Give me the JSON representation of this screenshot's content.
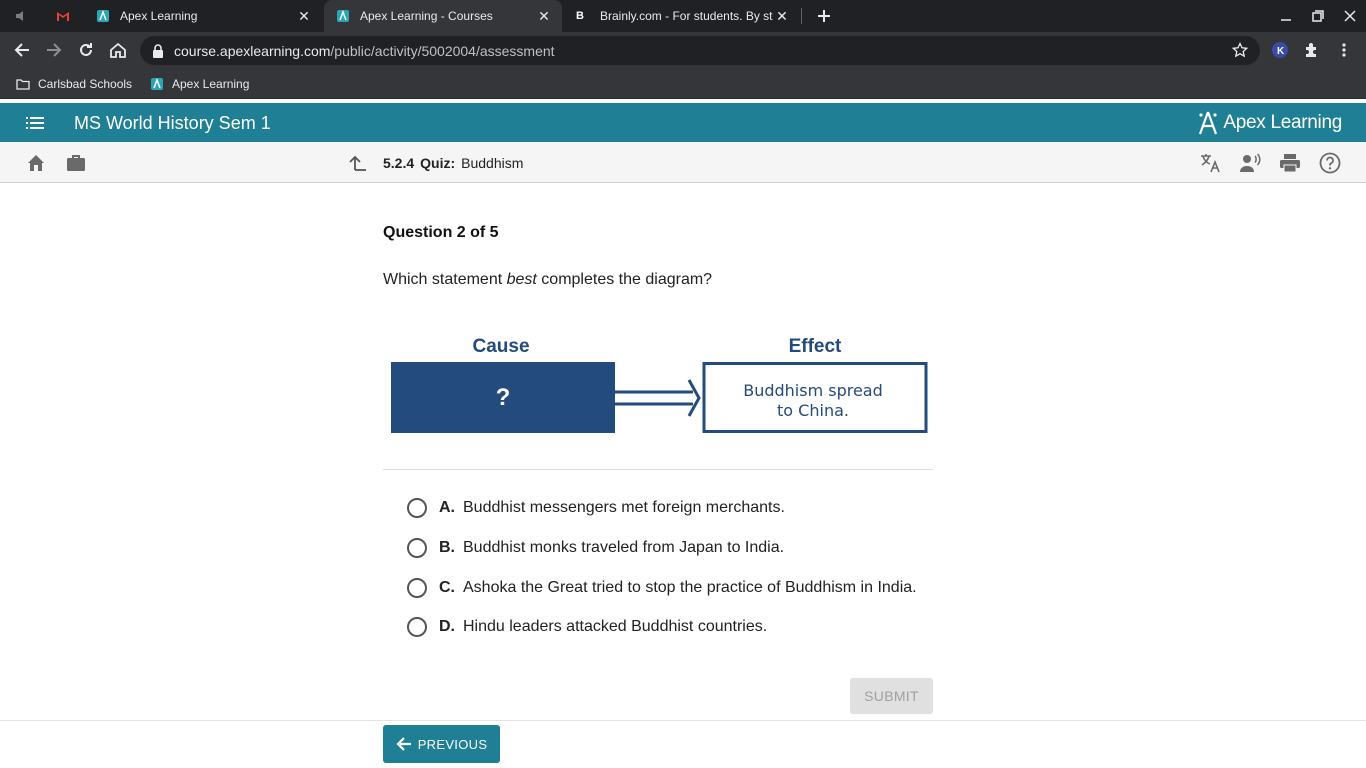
{
  "browser": {
    "tabs": [
      {
        "title": "",
        "favicon": "back-audio-icon"
      },
      {
        "title": "",
        "favicon": "gmail-icon"
      },
      {
        "title": "Apex Learning",
        "favicon": "apex-icon"
      },
      {
        "title": "Apex Learning - Courses",
        "favicon": "apex-icon",
        "active": true
      },
      {
        "title": "Brainly.com - For students. By st",
        "favicon": "brainly-icon"
      }
    ],
    "url_host": "course.apexlearning.com",
    "url_path": "/public/activity/5002004/assessment",
    "bookmarks": [
      {
        "label": "Carlsbad Schools",
        "icon": "folder-icon"
      },
      {
        "label": "Apex Learning",
        "icon": "apex-icon"
      }
    ]
  },
  "app": {
    "course_title": "MS World History Sem 1",
    "brand": "Apex Learning",
    "brand_color": "#1f7f95"
  },
  "breadcrumb": {
    "number": "5.2.4",
    "kind": "Quiz:",
    "name": "Buddhism"
  },
  "question": {
    "counter": "Question 2 of 5",
    "prompt_before": "Which statement ",
    "prompt_em": "best",
    "prompt_after": " completes the diagram?",
    "diagram": {
      "cause_label": "Cause",
      "effect_label": "Effect",
      "cause_text": "?",
      "effect_line1": "Buddhism spread",
      "effect_line2": "to China."
    },
    "choices": [
      {
        "letter": "A.",
        "text": "Buddhist messengers met foreign merchants."
      },
      {
        "letter": "B.",
        "text": "Buddhist monks traveled from Japan to India."
      },
      {
        "letter": "C.",
        "text": "Ashoka the Great tried to stop the practice of Buddhism in India."
      },
      {
        "letter": "D.",
        "text": "Hindu leaders attacked Buddhist countries."
      }
    ],
    "submit_label": "SUBMIT"
  },
  "footer": {
    "previous_label": "PREVIOUS"
  }
}
